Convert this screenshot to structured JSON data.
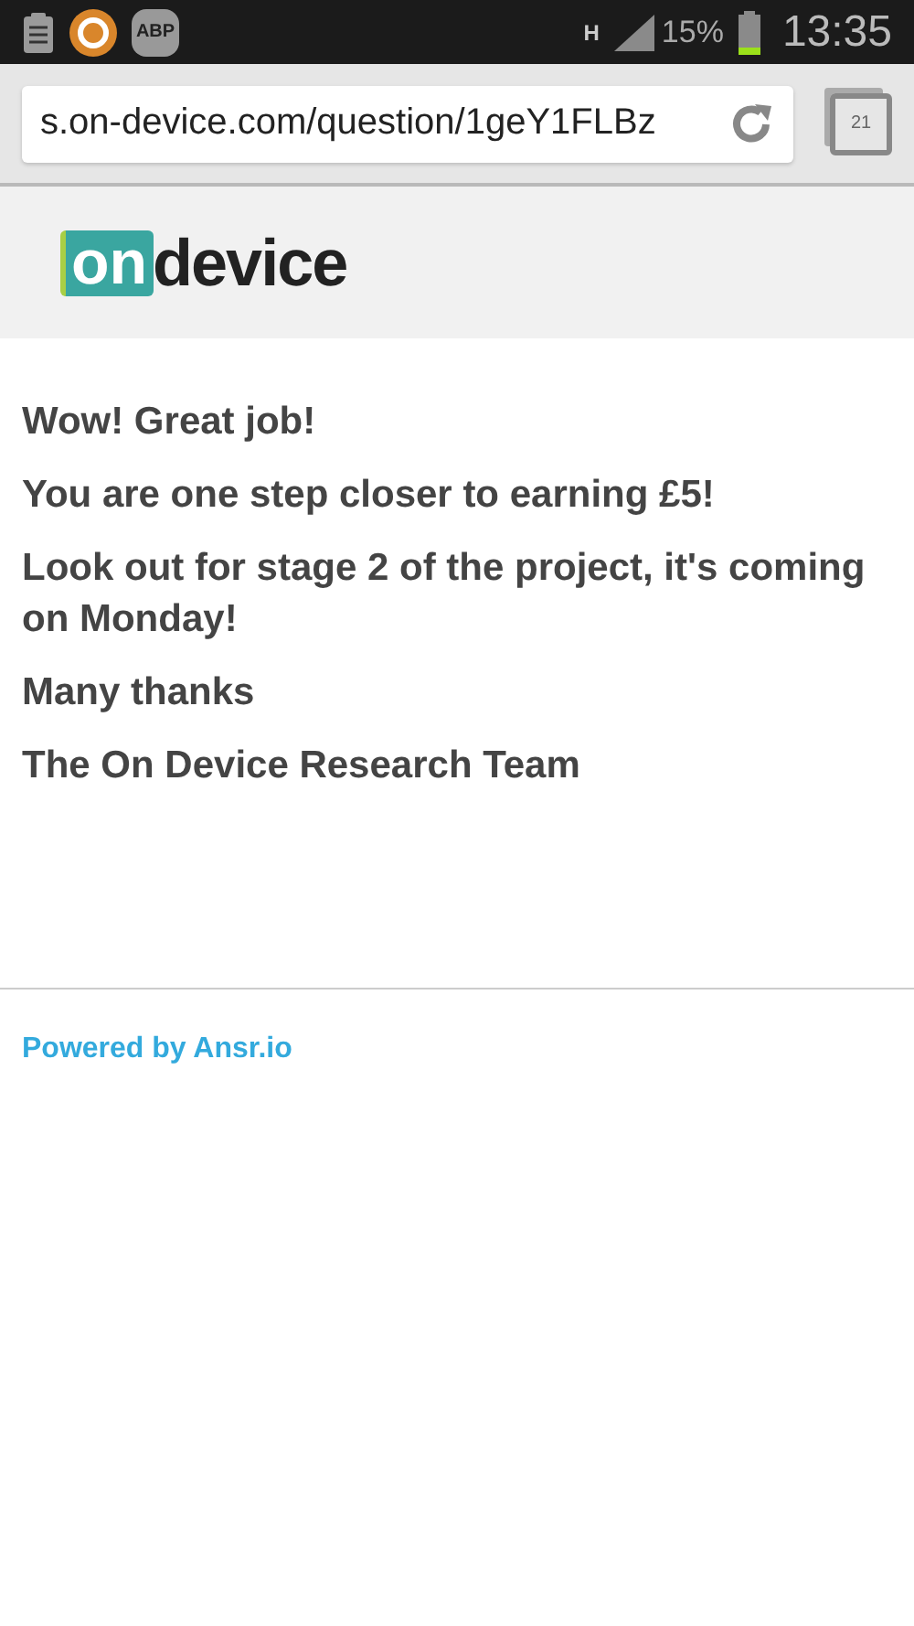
{
  "status_bar": {
    "adblock_label": "ABP",
    "network": "H",
    "battery": "15%",
    "time": "13:35"
  },
  "browser": {
    "url": "s.on-device.com/question/1geY1FLBz",
    "tab_count": "21"
  },
  "logo": {
    "highlight": "on",
    "rest": "device"
  },
  "messages": [
    "Wow! Great job!",
    "You are one step closer to earning £5!",
    "Look out for stage 2 of the project, it's coming on Monday!",
    "Many thanks",
    "The On Device Research Team"
  ],
  "footer": {
    "link": "Powered by Ansr.io"
  }
}
